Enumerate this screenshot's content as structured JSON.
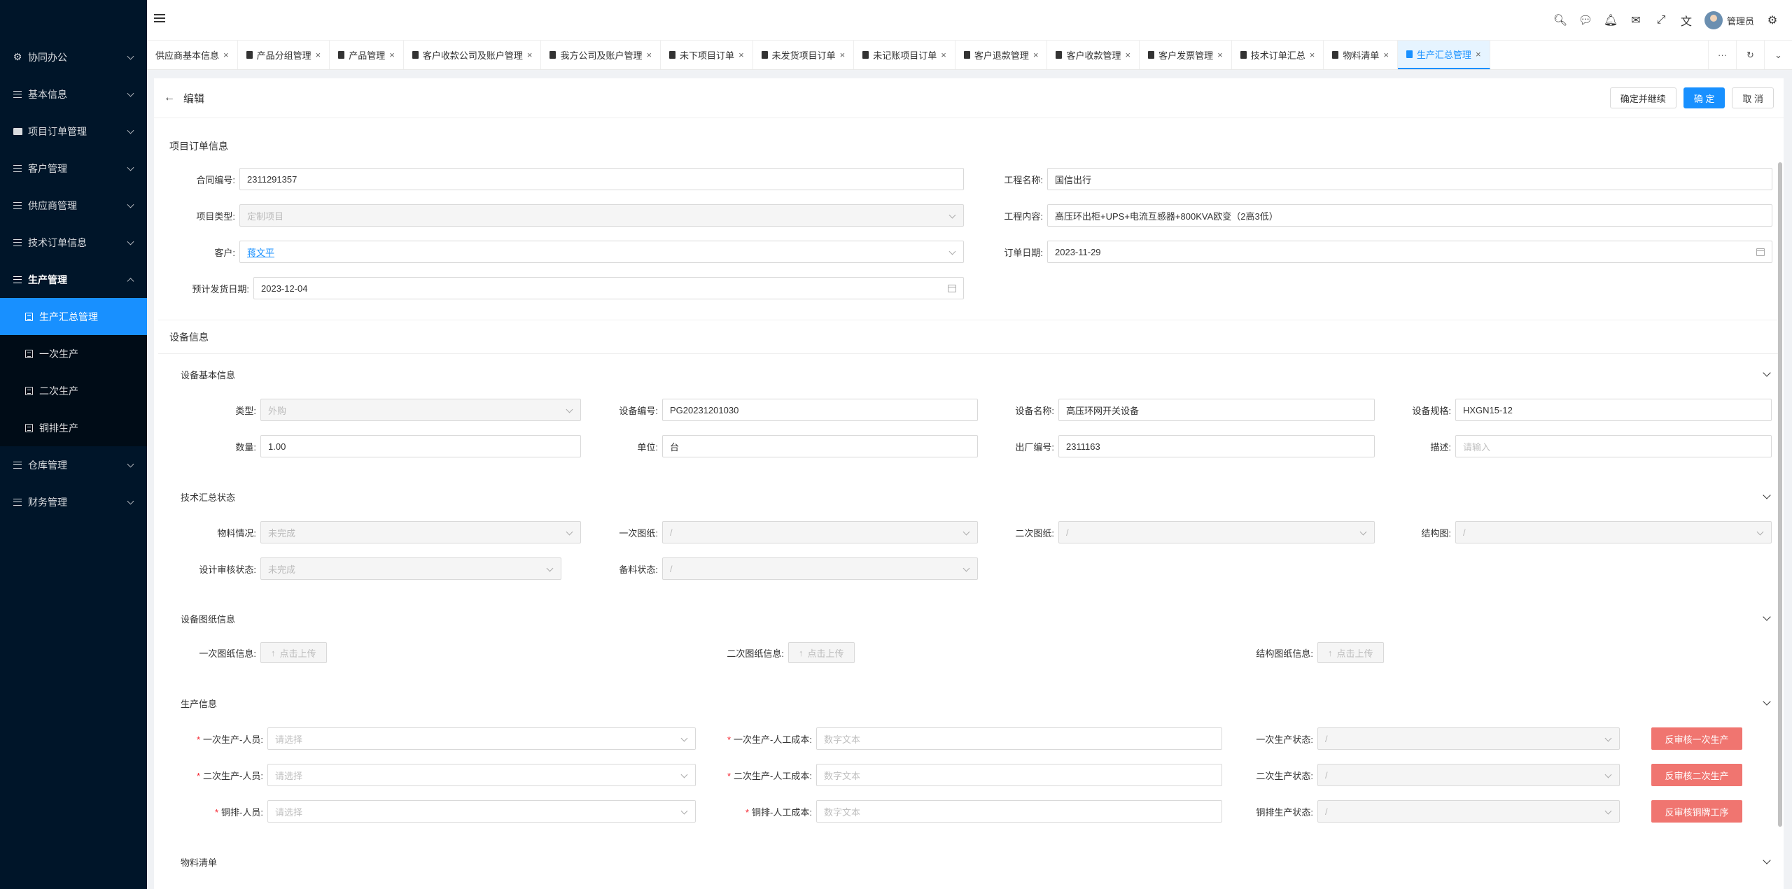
{
  "sidebar": {
    "items": [
      {
        "label": "协同办公"
      },
      {
        "label": "基本信息"
      },
      {
        "label": "项目订单管理"
      },
      {
        "label": "客户管理"
      },
      {
        "label": "供应商管理"
      },
      {
        "label": "技术订单信息"
      },
      {
        "label": "生产管理"
      },
      {
        "label": "仓库管理"
      },
      {
        "label": "财务管理"
      }
    ],
    "sub_items": [
      {
        "label": "生产汇总管理"
      },
      {
        "label": "一次生产"
      },
      {
        "label": "二次生产"
      },
      {
        "label": "铜排生产"
      }
    ]
  },
  "header": {
    "user_name": "管理员"
  },
  "tabs": [
    {
      "label": "供应商基本信息"
    },
    {
      "label": "产品分组管理"
    },
    {
      "label": "产品管理"
    },
    {
      "label": "客户收款公司及账户管理"
    },
    {
      "label": "我方公司及账户管理"
    },
    {
      "label": "未下项目订单"
    },
    {
      "label": "未发货项目订单"
    },
    {
      "label": "未记账项目订单"
    },
    {
      "label": "客户退款管理"
    },
    {
      "label": "客户收款管理"
    },
    {
      "label": "客户发票管理"
    },
    {
      "label": "技术订单汇总"
    },
    {
      "label": "物料清单"
    },
    {
      "label": "生产汇总管理"
    }
  ],
  "page": {
    "title": "编辑",
    "btn_confirm_continue": "确定并继续",
    "btn_confirm": "确 定",
    "btn_cancel": "取 消"
  },
  "order": {
    "section_title": "项目订单信息",
    "contract_no_label": "合同编号:",
    "contract_no": "2311291357",
    "project_name_label": "工程名称:",
    "project_name": "国信出行",
    "project_type_label": "项目类型:",
    "project_type": "定制项目",
    "project_content_label": "工程内容:",
    "project_content": "高压环出柜+UPS+电流互感器+800KVA欧变（2高3低）",
    "customer_label": "客户:",
    "customer": "蒋文平",
    "order_date_label": "订单日期:",
    "order_date": "2023-11-29",
    "ship_date_label": "预计发货日期:",
    "ship_date": "2023-12-04"
  },
  "device": {
    "section_title": "设备信息",
    "basic_title": "设备基本信息",
    "type_label": "类型:",
    "type": "外购",
    "device_no_label": "设备编号:",
    "device_no": "PG20231201030",
    "device_name_label": "设备名称:",
    "device_name": "高压环网开关设备",
    "spec_label": "设备规格:",
    "spec": "HXGN15-12",
    "qty_label": "数量:",
    "qty": "1.00",
    "unit_label": "单位:",
    "unit": "台",
    "factory_no_label": "出厂编号:",
    "factory_no": "2311163",
    "desc_label": "描述:",
    "desc_placeholder": "请输入"
  },
  "tech": {
    "title": "技术汇总状态",
    "material_label": "物料情况:",
    "material": "未完成",
    "primary_drawing_label": "一次图纸:",
    "primary_drawing": "/",
    "secondary_drawing_label": "二次图纸:",
    "secondary_drawing": "/",
    "structure_drawing_label": "结构图:",
    "structure_drawing": "/",
    "design_review_label": "设计审核状态:",
    "design_review": "未完成",
    "stock_label": "备料状态:",
    "stock": "/"
  },
  "drawings": {
    "title": "设备图纸信息",
    "primary_label": "一次图纸信息:",
    "secondary_label": "二次图纸信息:",
    "structure_label": "结构图纸信息:",
    "upload_text": "点击上传"
  },
  "production": {
    "title": "生产信息",
    "p1_staff_label": "一次生产-人员:",
    "p1_staff_placeholder": "请选择",
    "p1_cost_label": "一次生产-人工成本:",
    "p1_cost_placeholder": "数字文本",
    "p1_status_label": "一次生产状态:",
    "p1_status": "/",
    "p1_btn": "反审核一次生产",
    "p2_staff_label": "二次生产-人员:",
    "p2_staff_placeholder": "请选择",
    "p2_cost_label": "二次生产-人工成本:",
    "p2_cost_placeholder": "数字文本",
    "p2_status_label": "二次生产状态:",
    "p2_status": "/",
    "p2_btn": "反审核二次生产",
    "p3_staff_label": "铜排-人员:",
    "p3_staff_placeholder": "请选择",
    "p3_cost_label": "铜排-人工成本:",
    "p3_cost_placeholder": "数字文本",
    "p3_status_label": "铜排生产状态:",
    "p3_status": "/",
    "p3_btn": "反审核铜牌工序"
  },
  "materials": {
    "title": "物料清单"
  },
  "colors": {
    "primary": "#1890ff",
    "sidebar": "#001529",
    "danger_btn": "#f07570"
  }
}
